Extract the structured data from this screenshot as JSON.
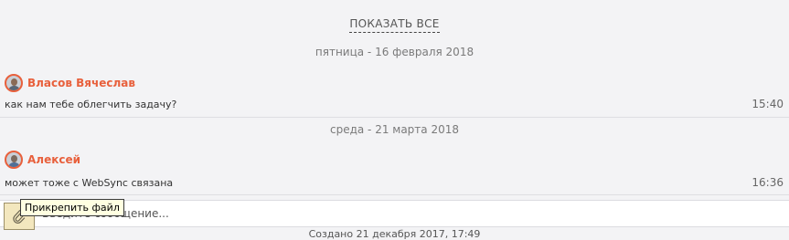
{
  "header": {
    "show_all_label": "ПОКАЗАТЬ ВСЕ"
  },
  "feed": {
    "groups": [
      {
        "date": "пятница - 16 февраля 2018",
        "message": {
          "author": "Власов Вячеслав",
          "text": "как нам тебе облегчить задачу?",
          "time": "15:40"
        }
      },
      {
        "date": "среда - 21 марта 2018",
        "message": {
          "author": "Алексей",
          "text": "может тоже с WebSync связана",
          "time": "16:36"
        }
      }
    ]
  },
  "composer": {
    "placeholder": "Введите сообщение...",
    "attach_tooltip": "Прикрепить файл",
    "attach_icon": "paperclip-icon"
  },
  "footer": {
    "created": "Создано 21 декабря 2017, 17:49"
  },
  "colors": {
    "author_name": "#e8603c",
    "avatar_ring": "#e8603c",
    "background": "#f3f3f5",
    "tooltip_bg": "#ffffe1",
    "attach_bg": "#f3e7be"
  }
}
